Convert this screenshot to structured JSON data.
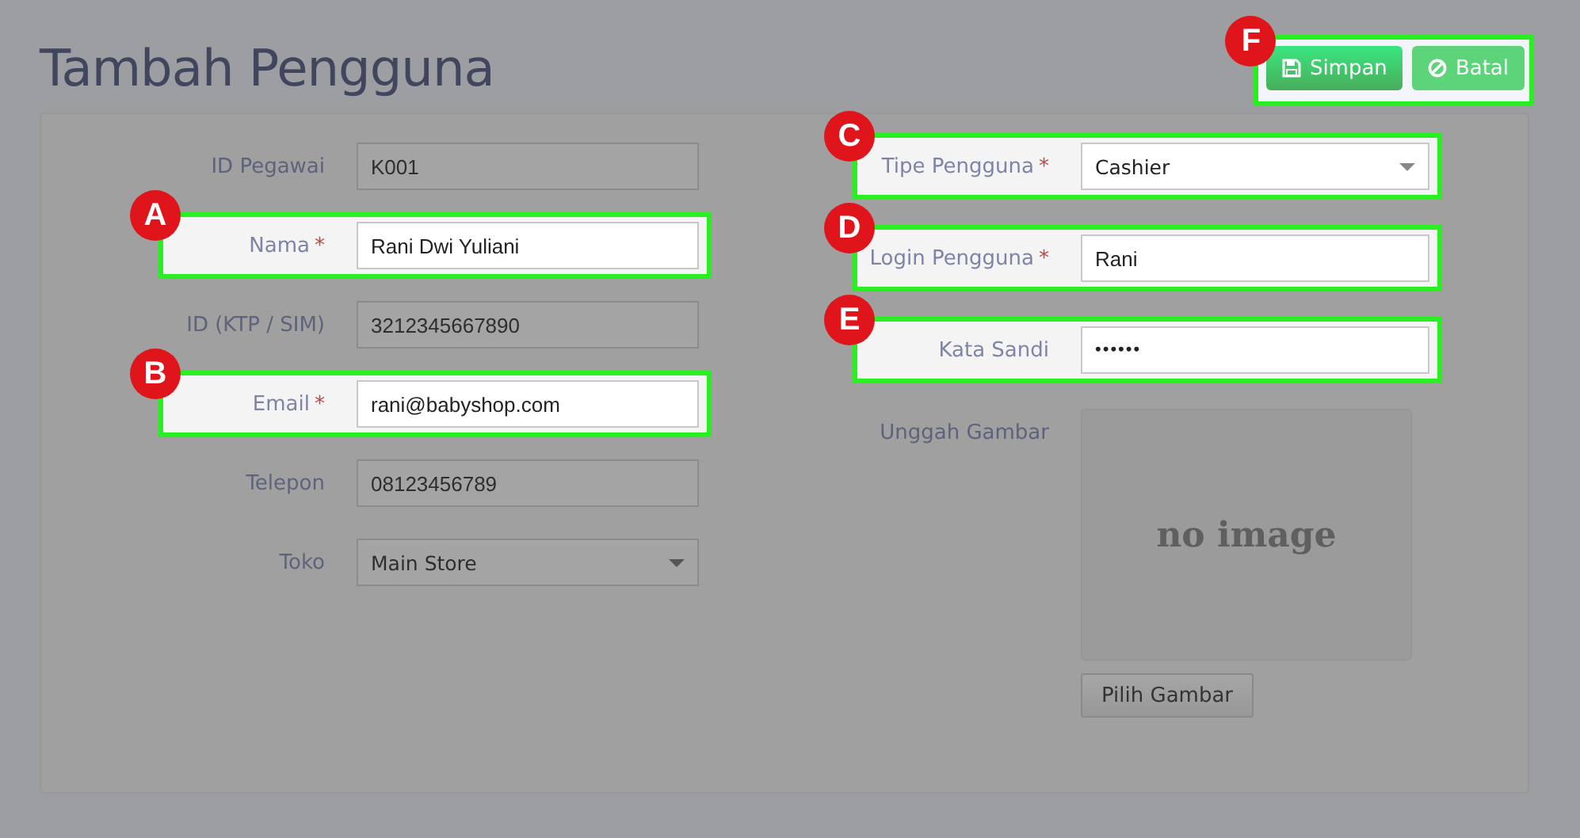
{
  "page": {
    "title": "Tambah Pengguna"
  },
  "actions": {
    "highlighted": true,
    "callout": "F",
    "buttons": [
      {
        "label": "Simpan",
        "kind": "save"
      },
      {
        "label": "Batal",
        "kind": "cancel"
      }
    ]
  },
  "left_fields": [
    {
      "label": "ID Pegawai",
      "value": "K001",
      "kind": "text",
      "highlighted": false
    },
    {
      "label": "Nama",
      "mark": "*",
      "value": "Rani Dwi Yuliani",
      "kind": "text",
      "highlighted": true,
      "callout": "A"
    },
    {
      "label": "ID (KTP / SIM)",
      "value": "3212345667890",
      "kind": "text",
      "highlighted": false
    },
    {
      "label": "Email",
      "mark": "*",
      "value": "rani@babyshop.com",
      "kind": "text",
      "highlighted": true,
      "callout": "B"
    },
    {
      "label": "Telepon",
      "value": "08123456789",
      "kind": "text",
      "highlighted": false
    },
    {
      "label": "Toko",
      "value": "Main Store",
      "kind": "select",
      "highlighted": false
    }
  ],
  "right_fields": [
    {
      "label": "Tipe Pengguna",
      "mark": "*",
      "value": "Cashier",
      "kind": "select",
      "highlighted": true,
      "callout": "C"
    },
    {
      "label": "Login Pengguna",
      "mark": "*",
      "value": "Rani",
      "kind": "text",
      "highlighted": true,
      "callout": "D"
    },
    {
      "label": "Kata Sandi",
      "value": "••••••",
      "kind": "password",
      "highlighted": true,
      "callout": "E"
    }
  ],
  "image_upload": {
    "label": "Unggah Gambar",
    "image_text": "no image",
    "button": "Pilih Gambar"
  }
}
